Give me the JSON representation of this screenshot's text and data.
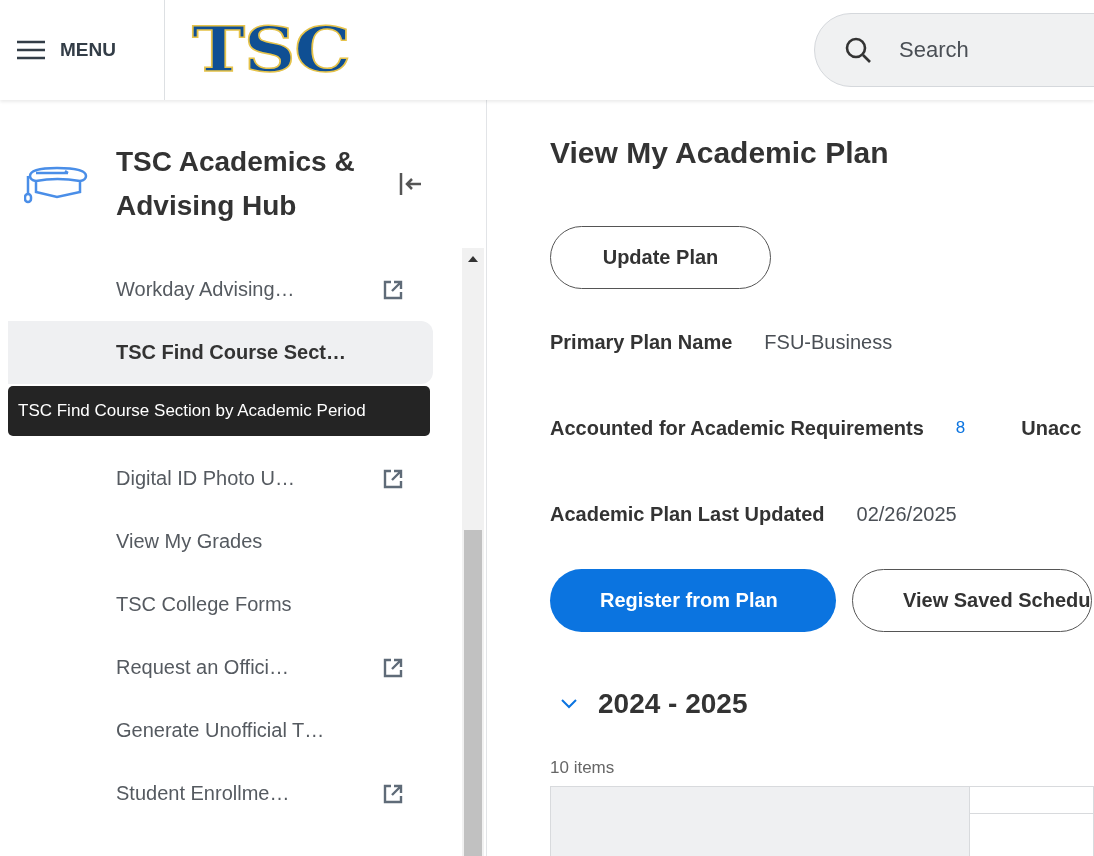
{
  "header": {
    "menu_label": "MENU",
    "logo": "TSC",
    "search": {
      "placeholder": "Search"
    }
  },
  "sidebar": {
    "title": "TSC Academics & Advising Hub",
    "tooltip": "TSC Find Course Section by Academic Period",
    "items": [
      {
        "kind": "link",
        "label": "Workday Advising…",
        "external": true,
        "selected": false
      },
      {
        "kind": "link",
        "label": "TSC Find Course Sect…",
        "external": false,
        "selected": true
      },
      {
        "kind": "covered"
      },
      {
        "kind": "link",
        "label": "Digital ID Photo U…",
        "external": true,
        "selected": false
      },
      {
        "kind": "link",
        "label": "View My Grades",
        "external": false,
        "selected": false
      },
      {
        "kind": "link",
        "label": "TSC College Forms",
        "external": false,
        "selected": false
      },
      {
        "kind": "link",
        "label": "Request an Offici…",
        "external": true,
        "selected": false
      },
      {
        "kind": "link",
        "label": "Generate Unofficial T…",
        "external": false,
        "selected": false
      },
      {
        "kind": "link",
        "label": "Student Enrollme…",
        "external": true,
        "selected": false
      }
    ]
  },
  "main": {
    "title": "View My Academic Plan",
    "update_button": {
      "label": "Update Plan",
      "kind": "secondary"
    },
    "fields": [
      {
        "cells": [
          {
            "kind": "label",
            "text": "Primary Plan Name"
          },
          {
            "kind": "value",
            "text": "FSU-Business"
          }
        ]
      },
      {
        "cells": [
          {
            "kind": "label",
            "text": "Accounted for Academic Requirements"
          },
          {
            "kind": "link",
            "text": "8"
          },
          {
            "kind": "label",
            "text": "Unacc"
          }
        ]
      },
      {
        "cells": [
          {
            "kind": "label",
            "text": "Academic Plan Last Updated"
          },
          {
            "kind": "value",
            "text": "02/26/2025"
          }
        ]
      }
    ],
    "buttons": [
      {
        "label": "Register from Plan",
        "kind": "primary"
      },
      {
        "label": "View Saved Schedu",
        "kind": "secondary"
      }
    ],
    "section": {
      "label": "2024 - 2025",
      "expanded": true,
      "count": "10 items"
    }
  }
}
